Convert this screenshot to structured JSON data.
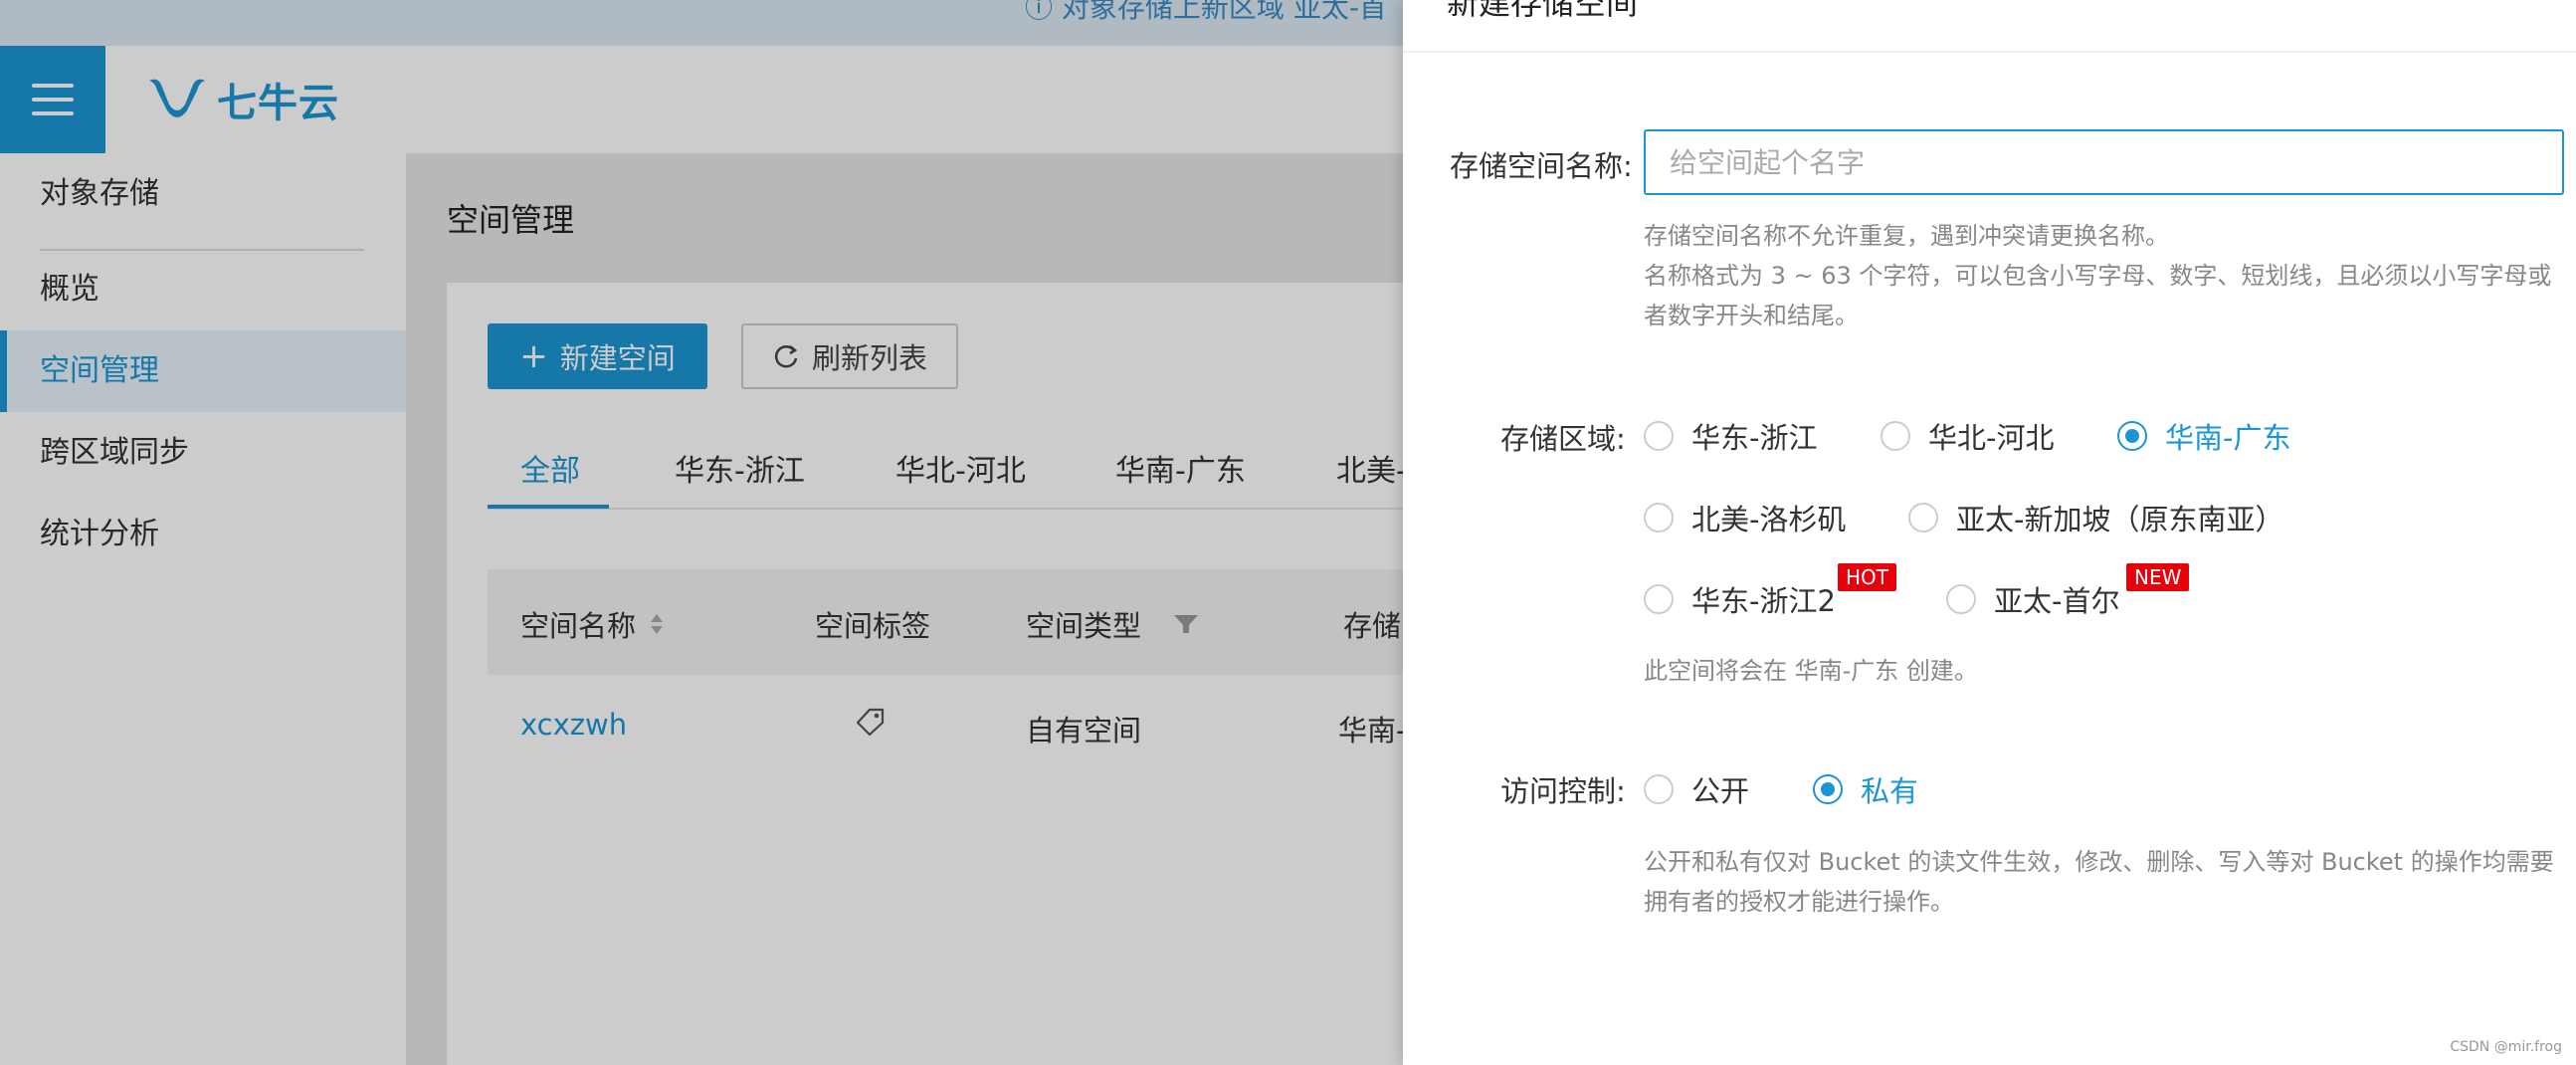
{
  "app": {
    "notice": "对象存储上新区域 亚太-首",
    "logo_text": "七牛云",
    "sidebar": [
      {
        "label": "对象存储"
      },
      {
        "label": "概览"
      },
      {
        "label": "空间管理"
      },
      {
        "label": "跨区域同步"
      },
      {
        "label": "统计分析"
      }
    ],
    "page_title": "空间管理",
    "buttons": {
      "create": "新建空间",
      "refresh": "刷新列表"
    },
    "tabs": [
      "全部",
      "华东-浙江",
      "华北-河北",
      "华南-广东",
      "北美-"
    ],
    "table": {
      "headers": [
        "空间名称",
        "空间标签",
        "空间类型",
        "存储"
      ],
      "rows": [
        {
          "name": "xcxzwh",
          "type": "自有空间",
          "region": "华南-"
        }
      ]
    }
  },
  "drawer": {
    "title": "新建存储空间",
    "name_label": "存储空间名称:",
    "name_placeholder": "给空间起个名字",
    "name_value": "",
    "name_help_1": "存储空间名称不允许重复，遇到冲突请更换名称。",
    "name_help_2": "名称格式为 3 ~ 63 个字符，可以包含小写字母、数字、短划线，且必须以小写字母或",
    "name_help_3": "者数字开头和结尾。",
    "region_label": "存储区域:",
    "regions": [
      {
        "label": "华东-浙江",
        "checked": false
      },
      {
        "label": "华北-河北",
        "checked": false
      },
      {
        "label": "华南-广东",
        "checked": true
      },
      {
        "label": "北美-洛杉矶",
        "checked": false
      },
      {
        "label": "亚太-新加坡（原东南亚）",
        "checked": false
      },
      {
        "label": "华东-浙江2",
        "checked": false,
        "badge": "HOT"
      },
      {
        "label": "亚太-首尔",
        "checked": false,
        "badge": "NEW"
      }
    ],
    "region_help": "此空间将会在 华南-广东 创建。",
    "access_label": "访问控制:",
    "access_options": [
      {
        "label": "公开",
        "checked": false
      },
      {
        "label": "私有",
        "checked": true
      }
    ],
    "access_help_1": "公开和私有仅对 Bucket 的读文件生效，修改、删除、写入等对 Bucket 的操作均需要",
    "access_help_2": "拥有者的授权才能进行操作。"
  },
  "watermark": "CSDN @mir.frog",
  "colors": {
    "accent": "#1b96d4",
    "badge": "#e8000b"
  }
}
